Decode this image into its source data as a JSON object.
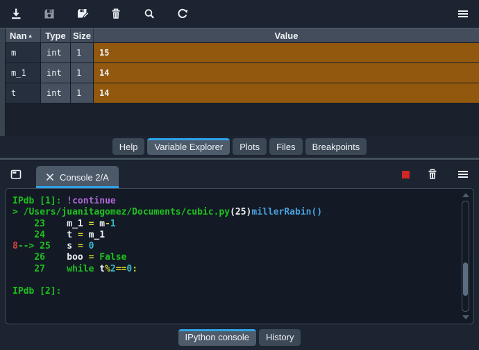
{
  "colors": {
    "accent_blue": "#2fa3e8",
    "value_cell_orange": "#92580e",
    "stop_red": "#cf2727",
    "green": "#1ec11e",
    "purple": "#b168d9",
    "blue": "#4aa0dd",
    "yellow": "#d3d32a",
    "cyan": "#35bac7",
    "red": "#d64141",
    "white": "#eef2f5"
  },
  "top_toolbar": {
    "icons": [
      "import-data-icon",
      "save-data-icon",
      "save-data-as-icon",
      "remove-all-variables-icon",
      "search-variable-icon",
      "refresh-variables-icon",
      "options-menu-icon"
    ]
  },
  "table": {
    "columns": {
      "name": "Nan",
      "sort_indicator": "▲",
      "type": "Type",
      "size": "Size",
      "value": "Value"
    },
    "rows": [
      {
        "name": "m",
        "type": "int",
        "size": "1",
        "value": "15"
      },
      {
        "name": "m_1",
        "type": "int",
        "size": "1",
        "value": "14"
      },
      {
        "name": "t",
        "type": "int",
        "size": "1",
        "value": "14"
      }
    ]
  },
  "pane_tabs": [
    {
      "label": "Help",
      "active": false
    },
    {
      "label": "Variable Explorer",
      "active": true
    },
    {
      "label": "Plots",
      "active": false
    },
    {
      "label": "Files",
      "active": false
    },
    {
      "label": "Breakpoints",
      "active": false
    }
  ],
  "console": {
    "tab_label": "Console 2/A",
    "close_glyph": "×",
    "lines": [
      [
        {
          "t": "IPdb [1]: ",
          "c": "green"
        },
        {
          "t": "!continue",
          "c": "purple"
        }
      ],
      [
        {
          "t": "> /Users/juanitagomez/Documents/cubic.py",
          "c": "green"
        },
        {
          "t": "(25)",
          "c": "white"
        },
        {
          "t": "millerRabin()",
          "c": "blue"
        }
      ],
      [
        {
          "t": "    23    ",
          "c": "green"
        },
        {
          "t": "m_1 ",
          "c": "white"
        },
        {
          "t": "= ",
          "c": "yellow"
        },
        {
          "t": "m",
          "c": "white"
        },
        {
          "t": "-",
          "c": "yellow"
        },
        {
          "t": "1",
          "c": "cyan"
        }
      ],
      [
        {
          "t": "    24    ",
          "c": "green"
        },
        {
          "t": "t ",
          "c": "white"
        },
        {
          "t": "= ",
          "c": "yellow"
        },
        {
          "t": "m_1",
          "c": "white"
        }
      ],
      [
        {
          "t": "8",
          "c": "red"
        },
        {
          "t": "--> ",
          "c": "green"
        },
        {
          "t": "25   ",
          "c": "green"
        },
        {
          "t": "s ",
          "c": "white"
        },
        {
          "t": "= ",
          "c": "yellow"
        },
        {
          "t": "0",
          "c": "cyan"
        }
      ],
      [
        {
          "t": "    26    ",
          "c": "green"
        },
        {
          "t": "boo ",
          "c": "white"
        },
        {
          "t": "= ",
          "c": "yellow"
        },
        {
          "t": "False",
          "c": "green"
        }
      ],
      [
        {
          "t": "    27    ",
          "c": "green"
        },
        {
          "t": "while ",
          "c": "green"
        },
        {
          "t": "t",
          "c": "white"
        },
        {
          "t": "%",
          "c": "yellow"
        },
        {
          "t": "2",
          "c": "cyan"
        },
        {
          "t": "==",
          "c": "yellow"
        },
        {
          "t": "0",
          "c": "cyan"
        },
        {
          "t": ":",
          "c": "yellow"
        }
      ],
      [],
      [
        {
          "t": "IPdb [2]:",
          "c": "green"
        }
      ]
    ]
  },
  "bottom_tabs": [
    {
      "label": "IPython console",
      "active": true
    },
    {
      "label": "History",
      "active": false
    }
  ]
}
